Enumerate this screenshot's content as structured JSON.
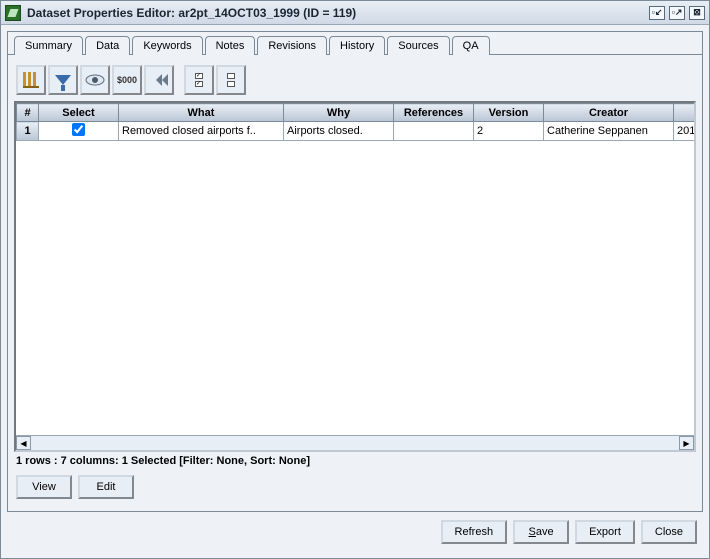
{
  "window": {
    "title": "Dataset Properties Editor: ar2pt_14OCT03_1999 (ID = 119)"
  },
  "tabs": [
    {
      "label": "Summary",
      "active": false
    },
    {
      "label": "Data",
      "active": false
    },
    {
      "label": "Keywords",
      "active": false
    },
    {
      "label": "Notes",
      "active": false
    },
    {
      "label": "Revisions",
      "active": true
    },
    {
      "label": "History",
      "active": false
    },
    {
      "label": "Sources",
      "active": false
    },
    {
      "label": "QA",
      "active": false
    }
  ],
  "toolbar": [
    {
      "name": "sort-icon",
      "tip": "Sort"
    },
    {
      "name": "filter-icon",
      "tip": "Filter"
    },
    {
      "name": "eye-icon",
      "tip": "Show/Hide columns"
    },
    {
      "name": "format-icon",
      "tip": "Format",
      "text": "$000"
    },
    {
      "name": "reset-icon",
      "tip": "Reset"
    },
    {
      "name": "select-all-icon",
      "tip": "Select All"
    },
    {
      "name": "clear-all-icon",
      "tip": "Clear All"
    }
  ],
  "columns": [
    "#",
    "Select",
    "What",
    "Why",
    "References",
    "Version",
    "Creator",
    ""
  ],
  "rows": [
    {
      "n": "1",
      "selected": true,
      "what": "Removed closed airports f..",
      "why": "Airports closed.",
      "references": "",
      "version": "2",
      "creator": "Catherine Seppanen",
      "date": "201"
    }
  ],
  "status": "1 rows : 7 columns: 1 Selected [Filter: None, Sort: None]",
  "actions": {
    "view": "View",
    "edit": "Edit",
    "refresh": "Refresh",
    "save": "Save",
    "export": "Export",
    "close": "Close"
  }
}
